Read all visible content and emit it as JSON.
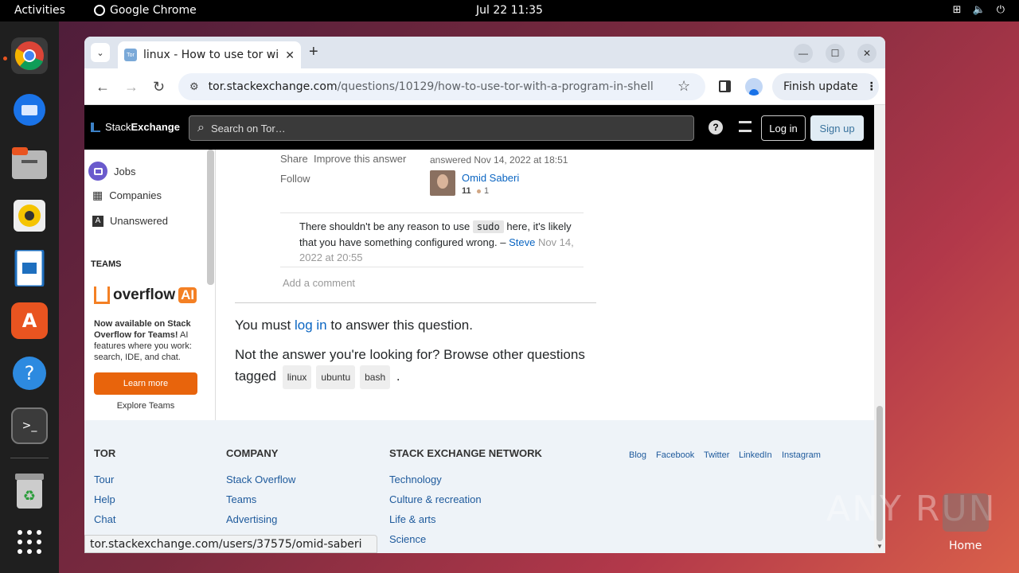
{
  "topbar": {
    "activities": "Activities",
    "app": "Google Chrome",
    "clock": "Jul 22  11:35",
    "tray_icons": [
      "network-icon",
      "volume-icon",
      "power-icon"
    ]
  },
  "dock": {
    "apps": [
      "chrome",
      "thunderbird",
      "files",
      "rhythmbox",
      "writer",
      "app-center",
      "help",
      "terminal",
      "trash",
      "show-apps"
    ]
  },
  "chrome": {
    "tab_title": "linux - How to use tor wi",
    "tab_favicon": "Tor",
    "url_host": "tor.stackexchange.com",
    "url_path": "/questions/10129/how-to-use-tor-with-a-program-in-shell",
    "finish_update": "Finish update",
    "status_url": "tor.stackexchange.com/users/37575/omid-saberi"
  },
  "se": {
    "logo_a": "Stack",
    "logo_b": "Exchange",
    "search_placeholder": "Search on Tor…",
    "login": "Log in",
    "signup": "Sign up"
  },
  "sidebar": {
    "jobs": "Jobs",
    "companies": "Companies",
    "unanswered": "Unanswered",
    "teams": "TEAMS",
    "overflow": "overflow",
    "ai": "AI",
    "promo_bold": "Now available on Stack Overflow for Teams!",
    "promo_rest": " AI features where you work: search, IDE, and chat.",
    "learn": "Learn more",
    "explore": "Explore Teams"
  },
  "answer": {
    "share": "Share",
    "improve": "Improve this answer",
    "follow": "Follow",
    "answered": "answered Nov 14, 2022 at 18:51",
    "user": "Omid Saberi",
    "rep": "11",
    "bronze": "1",
    "comment_pre": "There shouldn't be any reason to use ",
    "comment_code": "sudo",
    "comment_post": " here, it's likely that you have something configured wrong. – ",
    "comment_user": "Steve",
    "comment_date": "Nov 14, 2022 at 20:55",
    "add_comment": "Add a comment"
  },
  "main": {
    "must": "You must ",
    "login": "log in",
    "answer_q": " to answer this question.",
    "not_answer": "Not the answer you're looking for? Browse other questions tagged ",
    "tags": [
      "linux",
      "ubuntu",
      "bash"
    ],
    "period": "."
  },
  "footer": {
    "tor_h": "TOR",
    "tor_links": [
      "Tour",
      "Help",
      "Chat"
    ],
    "company_h": "COMPANY",
    "company_links": [
      "Stack Overflow",
      "Teams",
      "Advertising"
    ],
    "network_h": "STACK EXCHANGE NETWORK",
    "network_links": [
      "Technology",
      "Culture & recreation",
      "Life & arts",
      "Science"
    ],
    "social": [
      "Blog",
      "Facebook",
      "Twitter",
      "LinkedIn",
      "Instagram"
    ]
  },
  "watermark": "ANY RUN",
  "home_label": "Home"
}
